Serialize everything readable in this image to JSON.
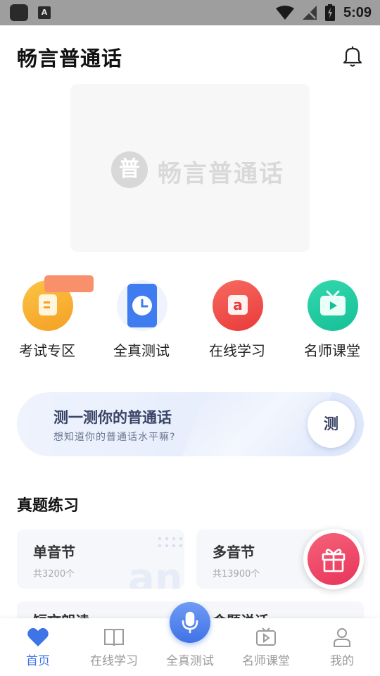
{
  "status_bar": {
    "time": "5:09",
    "icons": [
      "app-icon",
      "a-icon",
      "wifi-icon",
      "no-signal-icon",
      "battery-charging-icon"
    ]
  },
  "header": {
    "title": "畅言普通话",
    "notification_icon": "bell-icon"
  },
  "banner": {
    "logo_char": "普",
    "text": "畅言普通话"
  },
  "quick_menu": [
    {
      "label": "考试专区",
      "icon": "exam-icon",
      "color": "#f8a72a"
    },
    {
      "label": "全真测试",
      "icon": "clock-icon",
      "color": "#3f7cf0"
    },
    {
      "label": "在线学习",
      "icon": "letter-a-icon",
      "color": "#ef4a4a"
    },
    {
      "label": "名师课堂",
      "icon": "tv-icon",
      "color": "#1fc8a0"
    }
  ],
  "test_card": {
    "title": "测一测你的普通话",
    "subtitle": "想知道你的普通话水平嘛?",
    "button": "测"
  },
  "practice": {
    "title": "真题练习",
    "cards": [
      {
        "title": "单音节",
        "count": "共3200个"
      },
      {
        "title": "多音节",
        "count": "共13900个"
      },
      {
        "title": "短文朗读"
      },
      {
        "title": "命题说话"
      }
    ]
  },
  "tab_bar": [
    {
      "label": "首页",
      "icon": "heart-home-icon",
      "active": true
    },
    {
      "label": "在线学习",
      "icon": "book-icon",
      "active": false
    },
    {
      "label": "全真测试",
      "icon": "microphone-icon",
      "active": false
    },
    {
      "label": "名师课堂",
      "icon": "tv-play-icon",
      "active": false
    },
    {
      "label": "我的",
      "icon": "person-icon",
      "active": false
    }
  ],
  "colors": {
    "accent": "#3f74e6",
    "gift": "#e8345a"
  }
}
